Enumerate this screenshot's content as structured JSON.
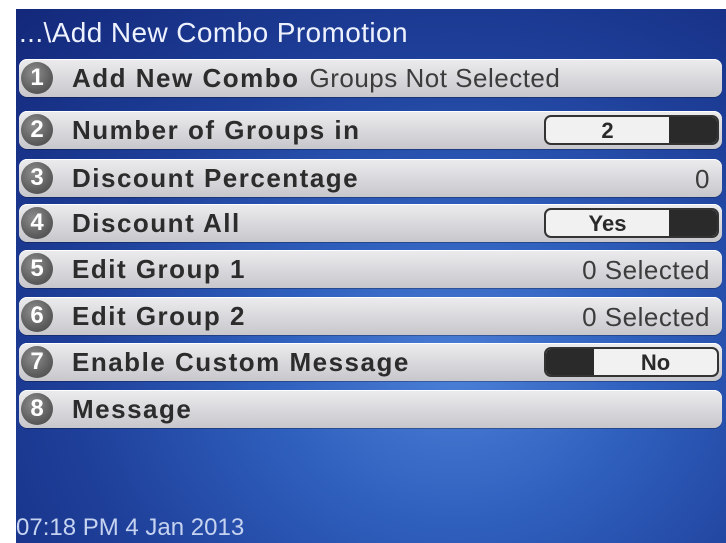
{
  "header": {
    "title": "...\\Add New Combo Promotion"
  },
  "menu": {
    "items": [
      {
        "number": "1",
        "label": "Add New Combo",
        "value": "Groups Not Selected"
      },
      {
        "number": "2",
        "label": "Number of Groups in",
        "value": "2"
      },
      {
        "number": "3",
        "label": "Discount Percentage",
        "value": "0"
      },
      {
        "number": "4",
        "label": "Discount All",
        "value": "Yes"
      },
      {
        "number": "5",
        "label": "Edit Group 1",
        "value": "0 Selected"
      },
      {
        "number": "6",
        "label": "Edit Group 2",
        "value": "0 Selected"
      },
      {
        "number": "7",
        "label": "Enable Custom Message",
        "value": "No"
      },
      {
        "number": "8",
        "label": "Message",
        "value": ""
      }
    ]
  },
  "status_bar": {
    "datetime": "07:18 PM 4 Jan 2013"
  },
  "colors": {
    "background_top": "#13287a",
    "background_center": "#4b7fd6",
    "row_fill": "#d8d8dc",
    "badge": "#5e5e5e",
    "toggle_knob": "#2a2a2a"
  }
}
